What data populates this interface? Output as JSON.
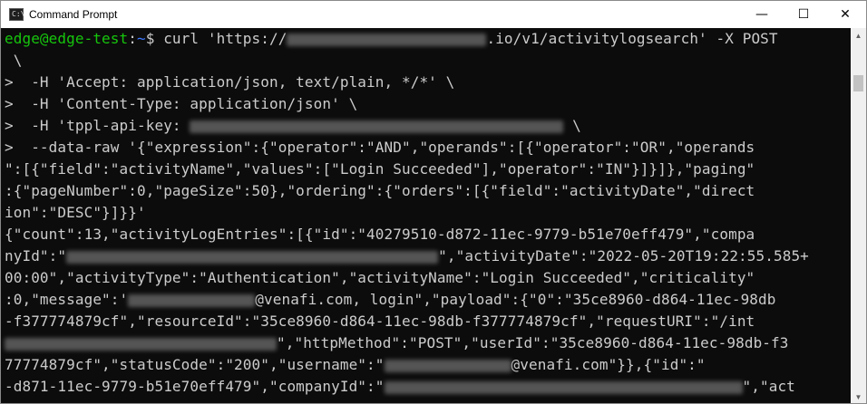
{
  "window": {
    "title": "Command Prompt",
    "icon_text": "C:\\",
    "controls": {
      "minimize": "—",
      "maximize": "☐",
      "close": "✕"
    }
  },
  "prompt": {
    "user_host": "edge@edge-test",
    "separator": ":",
    "path": "~",
    "symbol": "$"
  },
  "console": {
    "l1_cmd": " curl 'https://",
    "l1_rest": ".io/v1/activitylogsearch' -X POST",
    "l2": " \\",
    "l3": ">  -H 'Accept: application/json, text/plain, */*' \\",
    "l4": ">  -H 'Content-Type: application/json' \\",
    "l5_a": ">  -H 'tppl-api-key: ",
    "l5_b": " \\",
    "l6": ">  --data-raw '{\"expression\":{\"operator\":\"AND\",\"operands\":[{\"operator\":\"OR\",\"operands",
    "l7": "\":[{\"field\":\"activityName\",\"values\":[\"Login Succeeded\"],\"operator\":\"IN\"}]}]},\"paging\"",
    "l8": ":{\"pageNumber\":0,\"pageSize\":50},\"ordering\":{\"orders\":[{\"field\":\"activityDate\",\"direct",
    "l9": "ion\":\"DESC\"}]}}'",
    "l10": "{\"count\":13,\"activityLogEntries\":[{\"id\":\"40279510-d872-11ec-9779-b51e70eff479\",\"compa",
    "l11_a": "nyId\":\"",
    "l11_b": "\",\"activityDate\":\"2022-05-20T19:22:55.585+",
    "l12": "00:00\",\"activityType\":\"Authentication\",\"activityName\":\"Login Succeeded\",\"criticality\"",
    "l13_a": ":0,\"message\":'",
    "l13_b": "@venafi.com, login\",\"payload\":{\"0\":\"35ce8960-d864-11ec-98db",
    "l14": "-f377774879cf\",\"resourceId\":\"35ce8960-d864-11ec-98db-f377774879cf\",\"requestURI\":\"/int",
    "l15_b": "\",\"httpMethod\":\"POST\",\"userId\":\"35ce8960-d864-11ec-98db-f3",
    "l16_a": "77774879cf\",\"statusCode\":\"200\",\"username\":\"",
    "l16_b": "@venafi.com\"}},{\"id\":\"",
    "l17_a": "-d871-11ec-9779-b51e70eff479\",\"companyId\":\"",
    "l17_b": "\",\"act"
  }
}
